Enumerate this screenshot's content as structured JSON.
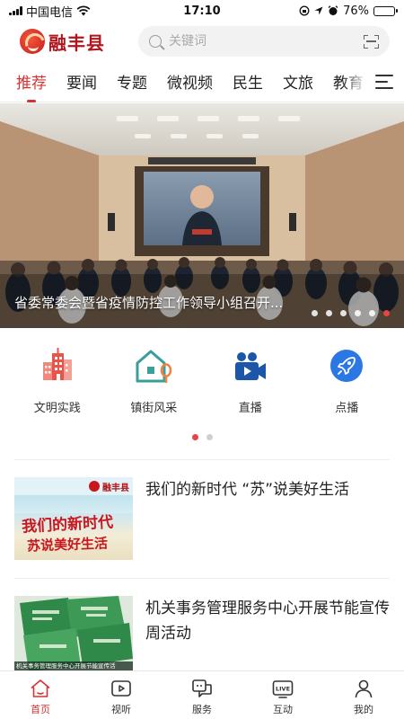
{
  "status_bar": {
    "carrier": "中国电信",
    "time": "17:10",
    "battery": "76%",
    "battery_level": 0.76
  },
  "header": {
    "logo_text": "融丰县",
    "search_placeholder": "关键词"
  },
  "tabs": [
    {
      "label": "推荐",
      "active": true
    },
    {
      "label": "要闻",
      "active": false
    },
    {
      "label": "专题",
      "active": false
    },
    {
      "label": "微视频",
      "active": false
    },
    {
      "label": "民生",
      "active": false
    },
    {
      "label": "文旅",
      "active": false
    },
    {
      "label": "教育",
      "active": false
    }
  ],
  "banner": {
    "caption": "省委常委会暨省疫情防控工作领导小组召开...",
    "slide_count": 6,
    "active_slide": 6
  },
  "shortcuts": [
    {
      "label": "文明实践",
      "icon": "city-buildings-icon",
      "color": "#e8534a"
    },
    {
      "label": "镇街风采",
      "icon": "house-tree-icon",
      "color": "#3a9e9a"
    },
    {
      "label": "直播",
      "icon": "video-camera-icon",
      "color": "#1b56a8"
    },
    {
      "label": "点播",
      "icon": "rocket-icon",
      "color": "#2b78e4"
    }
  ],
  "shortcut_pages": {
    "count": 2,
    "active": 1
  },
  "news": [
    {
      "title": "我们的新时代 “苏”说美好生活",
      "thumb_header": "融丰县",
      "thumb_line1": "我们的新时代",
      "thumb_line2": "苏说美好生活"
    },
    {
      "title": "机关事务管理服务中心开展节能宣传周活动",
      "thumb_caption": "机关事务管理服务中心开展节能宣传活"
    }
  ],
  "bottom_nav": [
    {
      "label": "首页",
      "icon": "home-icon",
      "active": true
    },
    {
      "label": "视听",
      "icon": "video-play-icon",
      "active": false
    },
    {
      "label": "服务",
      "icon": "service-chat-icon",
      "active": false
    },
    {
      "label": "互动",
      "icon": "live-tv-icon",
      "active": false
    },
    {
      "label": "我的",
      "icon": "user-icon",
      "active": false
    }
  ],
  "colors": {
    "accent": "#d63232",
    "logo": "#b0161c"
  }
}
